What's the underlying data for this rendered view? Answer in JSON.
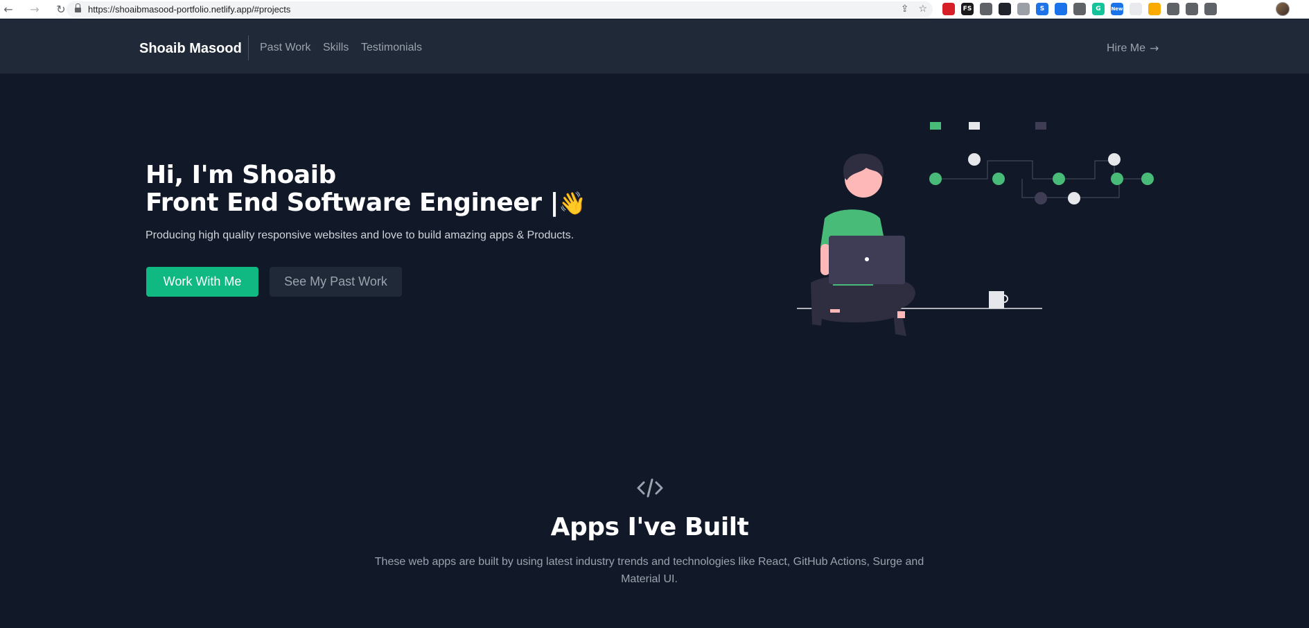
{
  "browser": {
    "url": "https://shoaibmasood-portfolio.netlify.app/#projects",
    "back_icon": "←",
    "forward_icon": "→",
    "reload_icon": "↻",
    "share_icon": "⇪",
    "star_icon": "☆",
    "extensions": [
      {
        "name": "opera-ext-icon",
        "color": "#d61f26",
        "label": ""
      },
      {
        "name": "fs-ext-icon",
        "color": "#1a1a1a",
        "label": "FS"
      },
      {
        "name": "eyedropper-ext-icon",
        "color": "#5f6368",
        "label": ""
      },
      {
        "name": "react-devtools-ext-icon",
        "color": "#20232a",
        "label": ""
      },
      {
        "name": "timer-ext-icon",
        "color": "#9aa0a6",
        "label": ""
      },
      {
        "name": "s-badge-ext-icon",
        "color": "#1e73e8",
        "label": "S"
      },
      {
        "name": "wave-ext-icon",
        "color": "#1a73e8",
        "label": ""
      },
      {
        "name": "coin-ext-icon",
        "color": "#5f6368",
        "label": ""
      },
      {
        "name": "grammarly-ext-icon",
        "color": "#15c39a",
        "label": "G"
      },
      {
        "name": "new-ext-icon",
        "color": "#1a73e8",
        "label": "New"
      },
      {
        "name": "calendar-ext-icon",
        "color": "#e8eaed",
        "label": ""
      },
      {
        "name": "pencil-ext-icon",
        "color": "#f9ab00",
        "label": ""
      },
      {
        "name": "move-ext-icon",
        "color": "#5f6368",
        "label": ""
      },
      {
        "name": "puzzle-ext-icon",
        "color": "#5f6368",
        "label": ""
      },
      {
        "name": "reading-list-icon",
        "color": "#5f6368",
        "label": ""
      }
    ]
  },
  "header": {
    "brand": "Shoaib Masood",
    "nav": [
      "Past Work",
      "Skills",
      "Testimonials"
    ],
    "cta": "Hire Me",
    "cta_icon": "→"
  },
  "hero": {
    "line1": "Hi, I'm Shoaib",
    "line2": "Front End Software Engineer |",
    "wave_emoji": "👋",
    "subtitle": "Producing high quality responsive websites and love to build amazing apps & Products.",
    "primary_button": "Work With Me",
    "secondary_button": "See My Past Work"
  },
  "projects": {
    "title": "Apps I've Built",
    "description": "These web apps are built by using latest industry trends and technologies like React, GitHub Actions, Surge and Material UI."
  },
  "colors": {
    "background": "#111827",
    "header_bg": "#1f2937",
    "accent": "#10b981",
    "illustration_green": "#48bb78"
  }
}
